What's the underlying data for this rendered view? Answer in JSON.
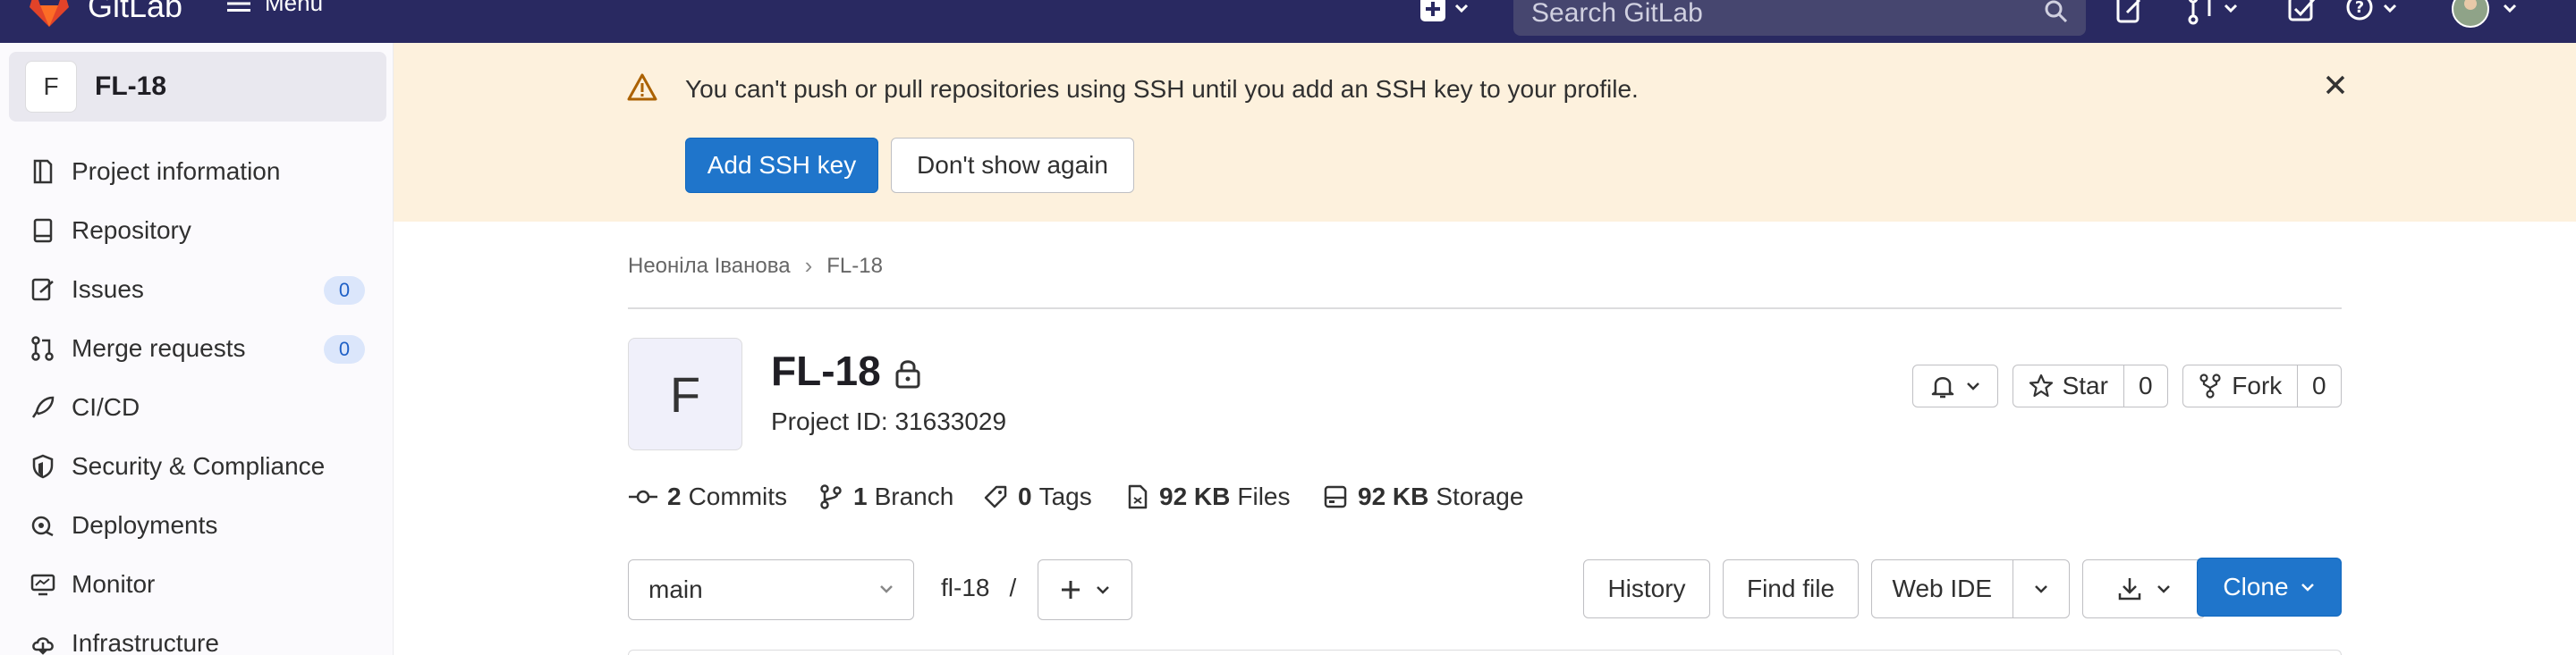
{
  "navbar": {
    "logo_text": "GitLab",
    "menu_label": "Menu",
    "search_placeholder": "Search GitLab"
  },
  "sidebar": {
    "project_letter": "F",
    "project_name": "FL-18",
    "items": [
      {
        "label": "Project information",
        "icon": "document-icon"
      },
      {
        "label": "Repository",
        "icon": "book-icon"
      },
      {
        "label": "Issues",
        "icon": "issues-icon",
        "count": "0"
      },
      {
        "label": "Merge requests",
        "icon": "merge-request-icon",
        "count": "0"
      },
      {
        "label": "CI/CD",
        "icon": "rocket-icon"
      },
      {
        "label": "Security & Compliance",
        "icon": "shield-icon"
      },
      {
        "label": "Deployments",
        "icon": "deployments-icon"
      },
      {
        "label": "Monitor",
        "icon": "monitor-icon"
      },
      {
        "label": "Infrastructure",
        "icon": "cloud-icon"
      }
    ]
  },
  "banner": {
    "message": "You can't push or pull repositories using SSH until you add an SSH key to your profile.",
    "add_ssh_key": "Add SSH key",
    "dont_show_again": "Don't show again"
  },
  "breadcrumb": {
    "owner": "Неоніла Іванова",
    "project": "FL-18"
  },
  "project": {
    "avatar_letter": "F",
    "title": "FL-18",
    "id_text": "Project ID: 31633029",
    "star_label": "Star",
    "star_count": "0",
    "fork_label": "Fork",
    "fork_count": "0"
  },
  "stats": {
    "commits_count": "2",
    "commits_label": "Commits",
    "branch_count": "1",
    "branch_label": "Branch",
    "tags_count": "0",
    "tags_label": "Tags",
    "files_size": "92 KB",
    "files_label": "Files",
    "storage_size": "92 KB",
    "storage_label": "Storage"
  },
  "repo_toolbar": {
    "branch": "main",
    "path_root": "fl-18",
    "path_sep": "/",
    "history": "History",
    "find_file": "Find file",
    "web_ide": "Web IDE",
    "clone": "Clone"
  },
  "colors": {
    "navbar": "#292961",
    "banner": "#fdf1dd",
    "primary": "#1f75cb",
    "sidebar_active": "#e9e8ef"
  }
}
